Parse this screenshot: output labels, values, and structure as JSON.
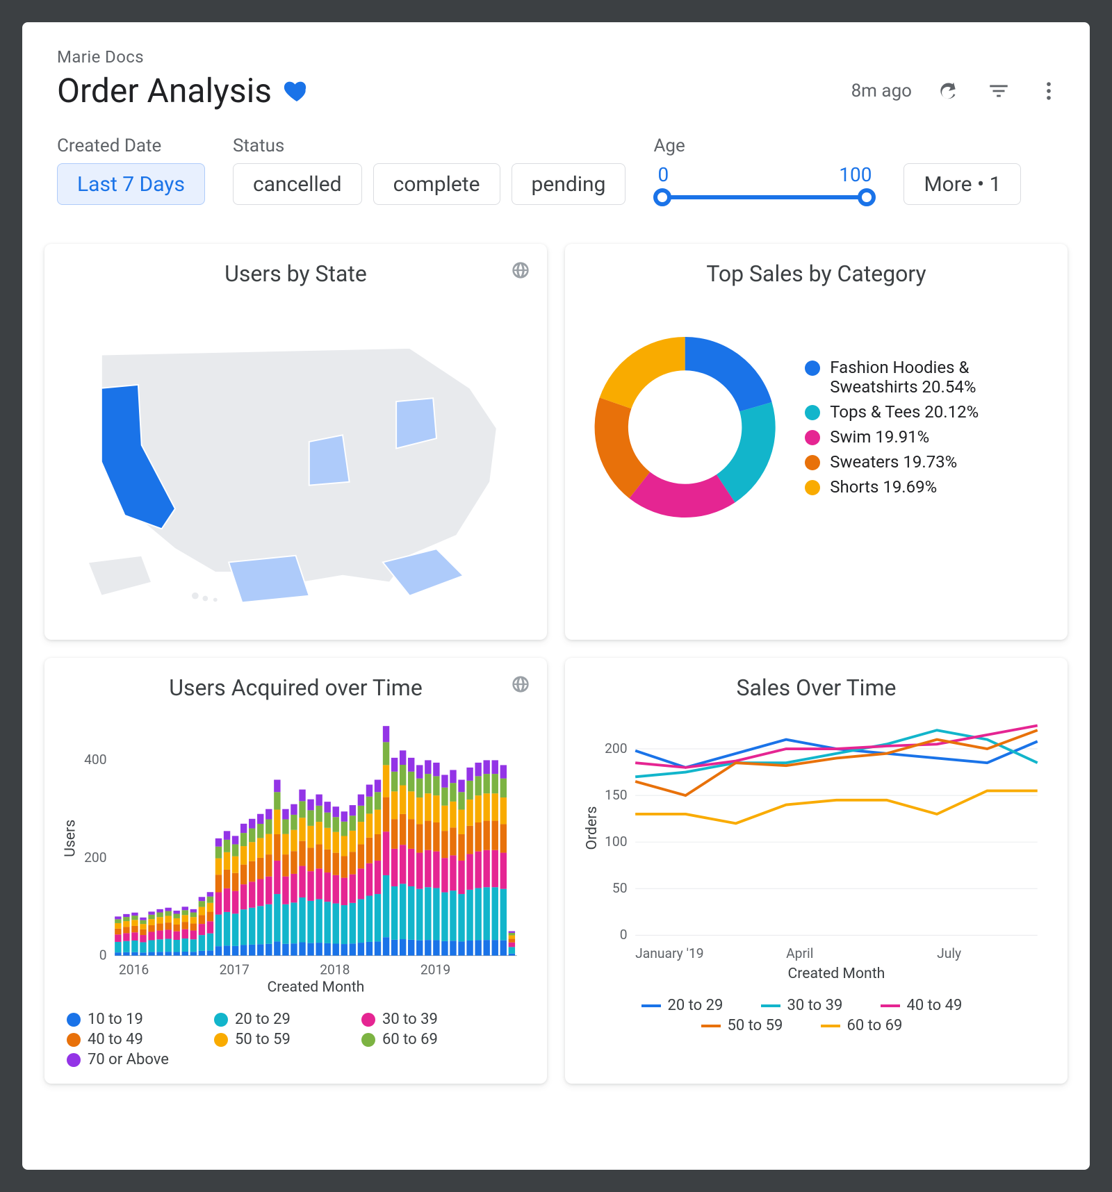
{
  "breadcrumb": "Marie Docs",
  "title": "Order Analysis",
  "header": {
    "updated": "8m ago"
  },
  "filters": {
    "createdDate": {
      "label": "Created Date",
      "selected": "Last 7 Days"
    },
    "status": {
      "label": "Status",
      "options": [
        "cancelled",
        "complete",
        "pending"
      ]
    },
    "age": {
      "label": "Age",
      "min": 0,
      "max": 100
    },
    "more": {
      "label": "More • 1"
    }
  },
  "colors": {
    "blue": "#1a73e8",
    "teal": "#12b5cb",
    "magenta": "#e52592",
    "orange": "#e8710a",
    "amber": "#f9ab00",
    "green": "#7cb342",
    "violet": "#9334e6"
  },
  "cards": {
    "map": {
      "title": "Users by State",
      "highlight": "#1a73e8",
      "mid": "#aecbfa",
      "low": "#e8eaed",
      "states_highlighted": [
        "California",
        "Texas",
        "Florida",
        "New York",
        "Illinois"
      ]
    },
    "donut": {
      "title": "Top Sales by Category",
      "series": [
        {
          "name": "Fashion Hoodies & Sweatshirts",
          "value": 20.54,
          "color": "#1a73e8"
        },
        {
          "name": "Tops & Tees",
          "value": 20.12,
          "color": "#12b5cb"
        },
        {
          "name": "Swim",
          "value": 19.91,
          "color": "#e52592"
        },
        {
          "name": "Sweaters",
          "value": 19.73,
          "color": "#e8710a"
        },
        {
          "name": "Shorts",
          "value": 19.69,
          "color": "#f9ab00"
        }
      ]
    },
    "stacked": {
      "title": "Users Acquired over Time",
      "ylabel": "Users",
      "xlabel": "Created Month",
      "ylim": [
        0,
        400
      ],
      "yticks": [
        0,
        200,
        400
      ],
      "xlabels": [
        "2016",
        "2017",
        "2018",
        "2019"
      ],
      "legend": [
        "10 to 19",
        "20 to 29",
        "30 to 39",
        "40 to 49",
        "50 to 59",
        "60 to 69",
        "70 or Above"
      ]
    },
    "lines": {
      "title": "Sales Over Time",
      "ylabel": "Orders",
      "xlabel": "Created Month",
      "ylim": [
        0,
        200
      ],
      "yticks": [
        0,
        50,
        100,
        150,
        200
      ],
      "xlabels": [
        "January '19",
        "April",
        "July"
      ],
      "legend": [
        "20 to 29",
        "30 to 39",
        "40 to 49",
        "50 to 59",
        "60 to 69"
      ]
    }
  },
  "chart_data": [
    {
      "type": "donut",
      "title": "Top Sales by Category",
      "series": [
        {
          "name": "Fashion Hoodies & Sweatshirts",
          "value": 20.54
        },
        {
          "name": "Tops & Tees",
          "value": 20.12
        },
        {
          "name": "Swim",
          "value": 19.91
        },
        {
          "name": "Sweaters",
          "value": 19.73
        },
        {
          "name": "Shorts",
          "value": 19.69
        }
      ]
    },
    {
      "type": "bar",
      "title": "Users Acquired over Time",
      "xlabel": "Created Month",
      "ylabel": "Users",
      "ylim": [
        0,
        480
      ],
      "x": [
        "2016-01",
        "2016-02",
        "2016-03",
        "2016-04",
        "2016-05",
        "2016-06",
        "2016-07",
        "2016-08",
        "2016-09",
        "2016-10",
        "2016-11",
        "2016-12",
        "2017-01",
        "2017-02",
        "2017-03",
        "2017-04",
        "2017-05",
        "2017-06",
        "2017-07",
        "2017-08",
        "2017-09",
        "2017-10",
        "2017-11",
        "2017-12",
        "2018-01",
        "2018-02",
        "2018-03",
        "2018-04",
        "2018-05",
        "2018-06",
        "2018-07",
        "2018-08",
        "2018-09",
        "2018-10",
        "2018-11",
        "2018-12",
        "2019-01",
        "2019-02",
        "2019-03",
        "2019-04",
        "2019-05",
        "2019-06",
        "2019-07",
        "2019-08",
        "2019-09",
        "2019-10",
        "2019-11",
        "2019-12"
      ],
      "series": [
        {
          "name": "10 to 19",
          "color": "#1a73e8"
        },
        {
          "name": "20 to 29",
          "color": "#12b5cb"
        },
        {
          "name": "30 to 39",
          "color": "#e52592"
        },
        {
          "name": "40 to 49",
          "color": "#e8710a"
        },
        {
          "name": "50 to 59",
          "color": "#f9ab00"
        },
        {
          "name": "60 to 69",
          "color": "#7cb342"
        },
        {
          "name": "70 or Above",
          "color": "#9334e6"
        }
      ],
      "totals": [
        80,
        85,
        88,
        78,
        90,
        95,
        98,
        92,
        100,
        95,
        120,
        130,
        240,
        255,
        245,
        270,
        280,
        290,
        300,
        360,
        300,
        310,
        340,
        320,
        330,
        315,
        305,
        295,
        308,
        330,
        350,
        360,
        470,
        405,
        420,
        405,
        390,
        400,
        395,
        370,
        380,
        360,
        385,
        395,
        400,
        400,
        390,
        50
      ]
    },
    {
      "type": "line",
      "title": "Sales Over Time",
      "xlabel": "Created Month",
      "ylabel": "Orders",
      "ylim": [
        0,
        230
      ],
      "x": [
        "Jan",
        "Feb",
        "Mar",
        "Apr",
        "May",
        "Jun",
        "Jul",
        "Aug",
        "Sep"
      ],
      "series": [
        {
          "name": "20 to 29",
          "color": "#1a73e8",
          "values": [
            198,
            180,
            195,
            210,
            200,
            195,
            190,
            185,
            208
          ]
        },
        {
          "name": "30 to 39",
          "color": "#12b5cb",
          "values": [
            170,
            175,
            185,
            185,
            195,
            205,
            220,
            210,
            185
          ]
        },
        {
          "name": "40 to 49",
          "color": "#e52592",
          "values": [
            185,
            180,
            187,
            200,
            200,
            203,
            205,
            215,
            225
          ]
        },
        {
          "name": "50 to 59",
          "color": "#e8710a",
          "values": [
            165,
            150,
            185,
            182,
            190,
            195,
            210,
            200,
            220
          ]
        },
        {
          "name": "60 to 69",
          "color": "#f9ab00",
          "values": [
            130,
            130,
            120,
            140,
            145,
            145,
            130,
            155,
            155
          ]
        }
      ]
    },
    {
      "type": "heatmap",
      "title": "Users by State",
      "note": "US choropleth; darker = more users",
      "highlighted_states": [
        "California",
        "Texas",
        "Florida",
        "New York",
        "Illinois"
      ]
    }
  ]
}
